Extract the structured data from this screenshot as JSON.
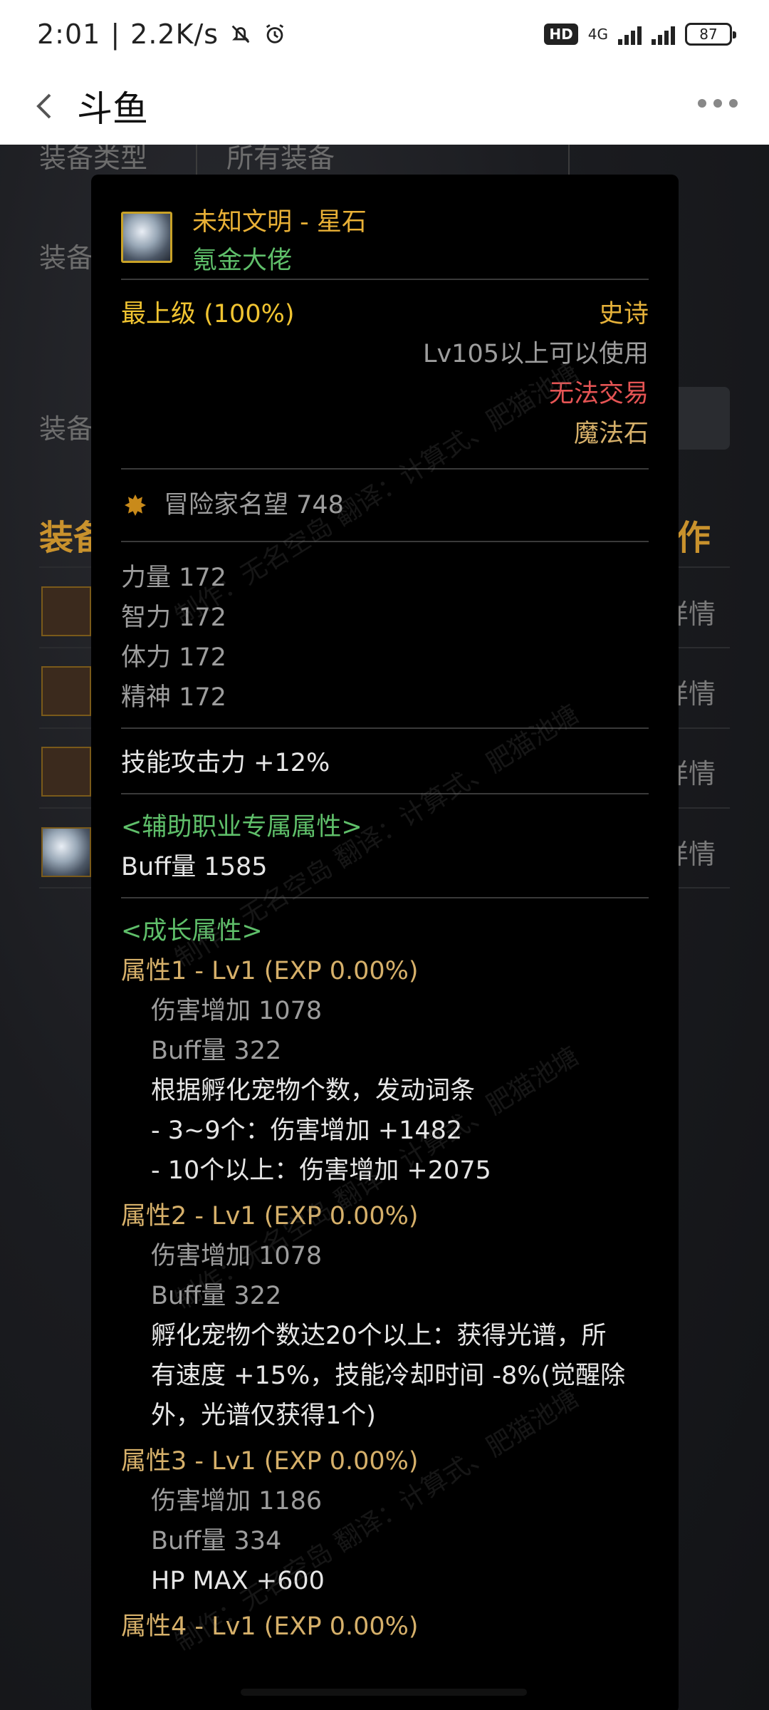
{
  "status_bar": {
    "time": "2:01",
    "net_speed": "2.2K/s",
    "hd_badge": "HD",
    "network": "4G",
    "battery": "87"
  },
  "nav": {
    "title": "斗鱼"
  },
  "background": {
    "type_label": "装备类型",
    "type_value": "所有装备",
    "equip_label_1": "装备",
    "equip_label_2": "装备",
    "section_left": "装备",
    "section_right": "作",
    "detail_1": "详情",
    "detail_2": "详情",
    "detail_3": "详情",
    "detail_4": "详情"
  },
  "tooltip": {
    "item_name": "未知文明 - 星石",
    "item_title": "氪金大佬",
    "grade": "最上级 (100%)",
    "rarity": "史诗",
    "level_req": "Lv105以上可以使用",
    "trade": "无法交易",
    "item_type": "魔法石",
    "fame": "冒险家名望 748",
    "stats": [
      "力量   172",
      "智力   172",
      "体力   172",
      "精神   172"
    ],
    "skill_attack": "技能攻击力   +12%",
    "support_header": "<辅助职业专属属性>",
    "buff_amount": "Buff量   1585",
    "growth_header": "<成长属性>",
    "attr1": {
      "title": "属性1 - Lv1 (EXP 0.00%)",
      "damage": "伤害增加   1078",
      "buff": "Buff量   322",
      "desc": [
        "根据孵化宠物个数，发动词条",
        "- 3~9个：伤害增加 +1482",
        "- 10个以上：伤害增加 +2075"
      ]
    },
    "attr2": {
      "title": "属性2 - Lv1 (EXP 0.00%)",
      "damage": "伤害增加   1078",
      "buff": "Buff量   322",
      "desc": [
        "孵化宠物个数达20个以上：获得光谱，所",
        "有速度 +15%，技能冷却时间 -8%(觉醒除",
        "外，光谱仅获得1个)"
      ]
    },
    "attr3": {
      "title": "属性3 - Lv1 (EXP 0.00%)",
      "damage": "伤害增加   1186",
      "buff": "Buff量   334",
      "desc": [
        "HP MAX +600"
      ]
    },
    "attr4": {
      "title": "属性4 - Lv1 (EXP 0.00%)"
    }
  },
  "watermark": "制作：无名空岛  翻译：计算式、肥猫池塘"
}
